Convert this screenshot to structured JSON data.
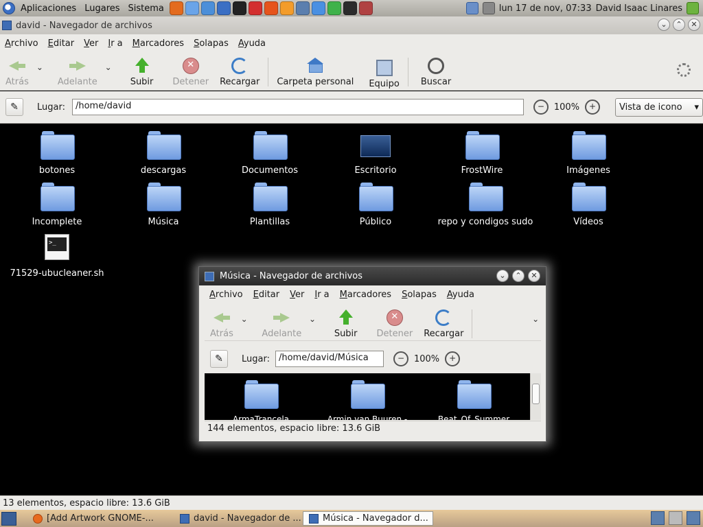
{
  "top_panel": {
    "menus": [
      "Aplicaciones",
      "Lugares",
      "Sistema"
    ],
    "launcher_colors": [
      "#e36b1e",
      "#6aa4e8",
      "#4c8fd9",
      "#3b6fc4",
      "#222222",
      "#d32f2f",
      "#e6541c",
      "#f39c2a",
      "#5b7fae",
      "#4a90e2",
      "#3fb24a",
      "#2b2b2b",
      "#b04242"
    ],
    "clock": "lun 17 de nov, 07:33",
    "user": "David Isaac Linares"
  },
  "main_window": {
    "title": "david - Navegador de archivos",
    "menu": [
      "Archivo",
      "Editar",
      "Ver",
      "Ir a",
      "Marcadores",
      "Solapas",
      "Ayuda"
    ],
    "toolbar": {
      "back": "Atrás",
      "forward": "Adelante",
      "up": "Subir",
      "stop": "Detener",
      "reload": "Recargar",
      "home": "Carpeta personal",
      "computer": "Equipo",
      "search": "Buscar"
    },
    "location": {
      "label": "Lugar:",
      "path": "/home/david",
      "zoom": "100%",
      "view_mode": "Vista de icono"
    },
    "items": [
      {
        "name": "botones",
        "icon": "folder-icon"
      },
      {
        "name": "descargas",
        "icon": "folder-icon"
      },
      {
        "name": "Documentos",
        "icon": "folder-icon"
      },
      {
        "name": "Escritorio",
        "icon": "desktop-icon"
      },
      {
        "name": "FrostWire",
        "icon": "folder-icon"
      },
      {
        "name": "Imágenes",
        "icon": "folder-icon"
      },
      {
        "name": "Incomplete",
        "icon": "folder-icon"
      },
      {
        "name": "Música",
        "icon": "folder-icon"
      },
      {
        "name": "Plantillas",
        "icon": "folder-icon"
      },
      {
        "name": "Público",
        "icon": "folder-icon"
      },
      {
        "name": "repo y condigos sudo",
        "icon": "folder-icon"
      },
      {
        "name": "Vídeos",
        "icon": "folder-icon"
      },
      {
        "name": "71529-ubucleaner.sh",
        "icon": "script-icon"
      }
    ],
    "status": "13 elementos, espacio libre: 13.6 GiB"
  },
  "music_window": {
    "title": "Música - Navegador de archivos",
    "menu": [
      "Archivo",
      "Editar",
      "Ver",
      "Ir a",
      "Marcadores",
      "Solapas",
      "Ayuda"
    ],
    "toolbar": {
      "back": "Atrás",
      "forward": "Adelante",
      "up": "Subir",
      "stop": "Detener",
      "reload": "Recargar"
    },
    "location": {
      "label": "Lugar:",
      "path": "/home/david/Música",
      "zoom": "100%"
    },
    "items": [
      "ArmaTrancela",
      "Armin van Buuren -",
      "Beat_Of_Summer"
    ],
    "status": "144 elementos, espacio libre: 13.6 GiB"
  },
  "taskbar": {
    "tasks": [
      {
        "label": "[Add Artwork GNOME-...",
        "icon": "firefox-icon",
        "active": false
      },
      {
        "label": "david - Navegador de ...",
        "icon": "file-manager-icon",
        "active": false
      },
      {
        "label": "Música - Navegador d...",
        "icon": "file-manager-icon",
        "active": true
      }
    ]
  }
}
